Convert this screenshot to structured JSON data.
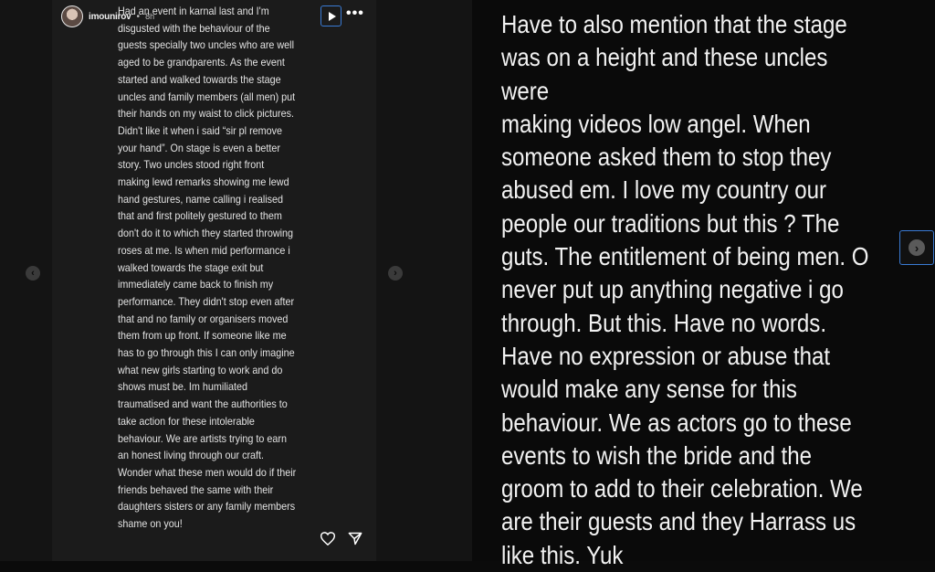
{
  "story": {
    "username": "imounirov",
    "time": "8h",
    "text": "Had an event  in karnal last and I'm disgusted with the behaviour of the guests specially two uncles who are well aged to be grandparents. As the event started and walked towards the stage uncles and family members (all men) put their hands on my waist to click pictures. Didn't like it when i said “sir pl remove your hand”. On stage is even a better story. Two uncles stood right front making lewd remarks showing me lewd hand gestures, name calling i realised that and first politely gestured to them don't do it to which they started throwing roses at me. Is when mid performance i walked towards the stage exit but immediately came back to finish my performance. They didn't stop even after that and no family or organisers moved them from up front. If someone like me has to go through this I can only imagine what new girls starting to work and do shows must be. Im humiliated traumatised and want the authorities to take action for these intolerable behaviour. We are artists trying to earn an honest living through our craft. Wonder what these men would do if their friends behaved the same with their daughters sisters or any family members shame on you!",
    "icons": {
      "play": "play-icon",
      "more": "more-dots-icon",
      "like": "heart-icon",
      "share": "send-icon"
    }
  },
  "nav": {
    "prev_symbol": "‹",
    "next_symbol": "›"
  },
  "right": {
    "text": "Have to also mention that the stage\nwas on a height and these uncles were\nmaking videos low angel. When\nsomeone asked them to stop they\nabused em. I love my country our\npeople our traditions but this ? The\nguts. The entitlement of being men. O\nnever put up anything negative i go\nthrough. But this. Have no words.\nHave no expression or abuse that\nwould make any sense for this\nbehaviour. We as actors go to these\nevents to wish the bride and the\ngroom to add to their celebration. We\nare their guests and they Harrass us\nlike this. Yuk"
  },
  "colors": {
    "accent": "#3a7bd5",
    "background": "#0b0b0b",
    "card": "#1b1b1b",
    "text": "#f2f2f2"
  }
}
